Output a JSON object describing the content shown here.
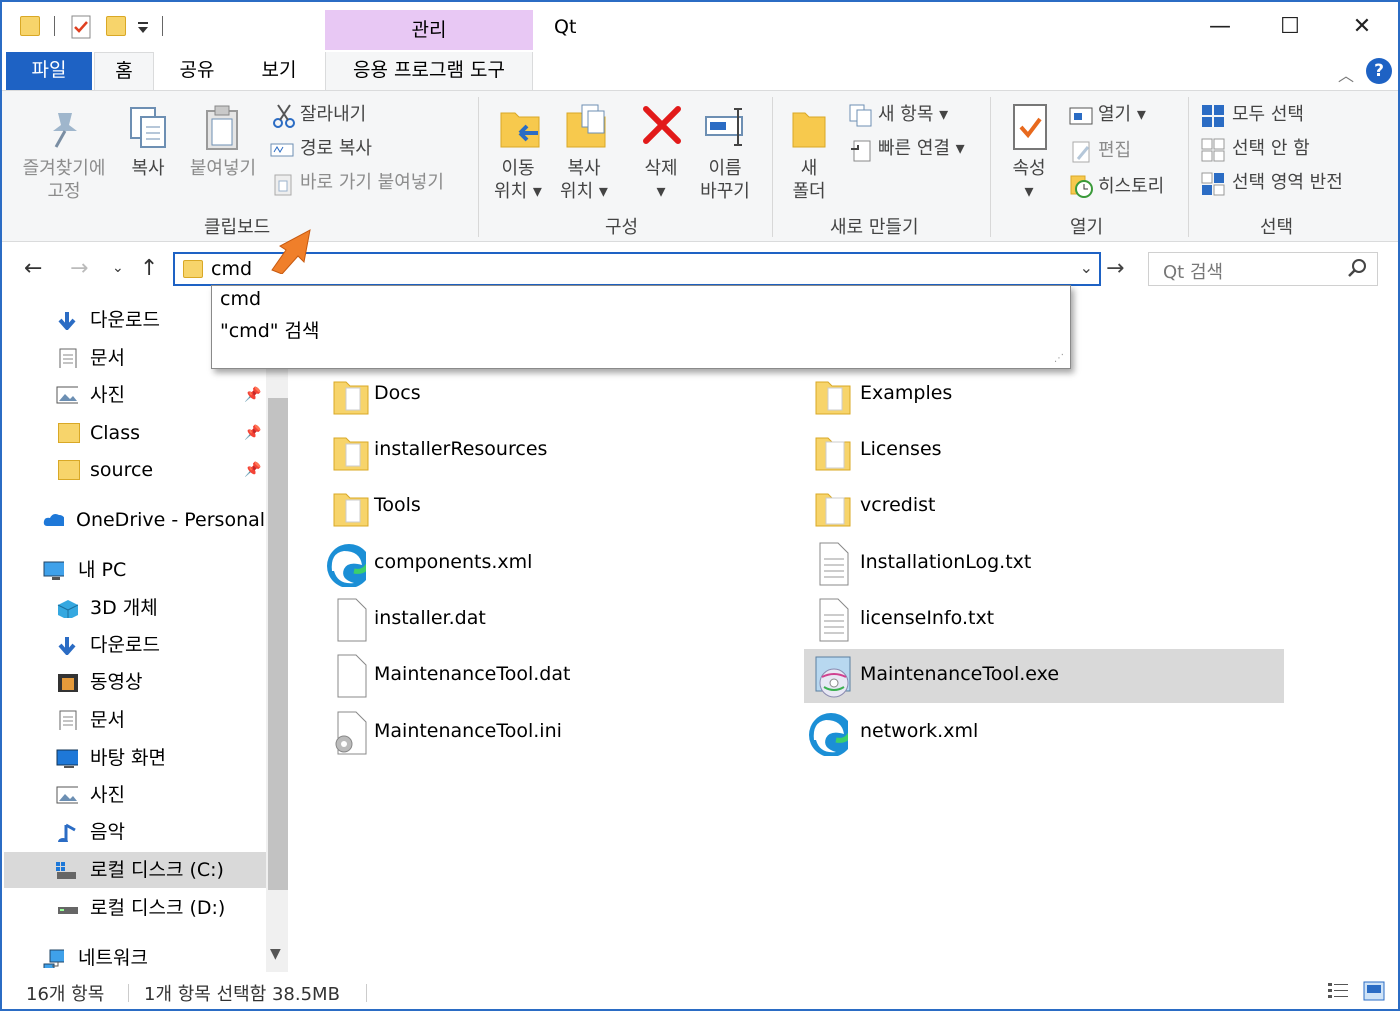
{
  "window": {
    "title": "Qt",
    "context_tab_header": "관리",
    "controls": {
      "minimize": "—",
      "maximize": "☐",
      "close": "✕"
    },
    "accent": "#1e62c4"
  },
  "tabs": [
    {
      "label": "파일"
    },
    {
      "label": "홈"
    },
    {
      "label": "공유"
    },
    {
      "label": "보기"
    },
    {
      "label": "응용 프로그램 도구"
    }
  ],
  "ribbon": {
    "clipboard": {
      "name": "클립보드",
      "pin_label_1": "즐겨찾기에",
      "pin_label_2": "고정",
      "copy": "복사",
      "paste": "붙여넣기",
      "cut": "잘라내기",
      "copy_path": "경로 복사",
      "paste_shortcut": "바로 가기 붙여넣기"
    },
    "organize": {
      "name": "구성",
      "move_1": "이동",
      "move_2": "위치 ▾",
      "copyto_1": "복사",
      "copyto_2": "위치 ▾",
      "delete_1": "삭제",
      "delete_2": "▾",
      "rename_1": "이름",
      "rename_2": "바꾸기"
    },
    "new": {
      "name": "새로 만들기",
      "folder_1": "새",
      "folder_2": "폴더",
      "new_item": "새 항목 ▾",
      "easy_access": "빠른 연결 ▾"
    },
    "open": {
      "name": "열기",
      "properties": "속성",
      "properties_dd": "▾",
      "open": "열기 ▾",
      "edit": "편집",
      "history": "히스토리"
    },
    "select": {
      "name": "선택",
      "select_all": "모두 선택",
      "select_none": "선택 안 함",
      "invert": "선택 영역 반전"
    }
  },
  "address": {
    "value": "cmd",
    "search_placeholder": "Qt 검색"
  },
  "autocomplete": [
    "cmd",
    "\"cmd\" 검색"
  ],
  "sidebar": [
    {
      "label": "다운로드",
      "icon": "download-icon",
      "pinned": false
    },
    {
      "label": "문서",
      "icon": "document-icon",
      "pinned": false
    },
    {
      "label": "사진",
      "icon": "pictures-icon",
      "pinned": true
    },
    {
      "label": "Class",
      "icon": "folder-icon",
      "pinned": true
    },
    {
      "label": "source",
      "icon": "folder-icon",
      "pinned": true
    },
    {
      "label": "OneDrive - Personal",
      "icon": "onedrive-icon",
      "pinned": false
    },
    {
      "label": "내 PC",
      "icon": "pc-icon",
      "pinned": false
    },
    {
      "label": "3D 개체",
      "icon": "3d-objects-icon",
      "pinned": false
    },
    {
      "label": "다운로드",
      "icon": "download-icon",
      "pinned": false
    },
    {
      "label": "동영상",
      "icon": "video-icon",
      "pinned": false
    },
    {
      "label": "문서",
      "icon": "document-icon",
      "pinned": false
    },
    {
      "label": "바탕 화면",
      "icon": "desktop-icon",
      "pinned": false
    },
    {
      "label": "사진",
      "icon": "pictures-icon",
      "pinned": false
    },
    {
      "label": "음악",
      "icon": "music-icon",
      "pinned": false
    },
    {
      "label": "로컬 디스크 (C:)",
      "icon": "drive-c-icon",
      "pinned": false
    },
    {
      "label": "로컬 디스크 (D:)",
      "icon": "drive-d-icon",
      "pinned": false
    },
    {
      "label": "네트워크",
      "icon": "network-icon",
      "pinned": false
    }
  ],
  "files": [
    {
      "name": "Docs",
      "icon": "folder-icon"
    },
    {
      "name": "Examples",
      "icon": "folder-icon"
    },
    {
      "name": "installerResources",
      "icon": "folder-icon"
    },
    {
      "name": "Licenses",
      "icon": "folder-icon"
    },
    {
      "name": "Tools",
      "icon": "folder-icon"
    },
    {
      "name": "vcredist",
      "icon": "folder-icon"
    },
    {
      "name": "components.xml",
      "icon": "edge-icon"
    },
    {
      "name": "InstallationLog.txt",
      "icon": "text-file-icon"
    },
    {
      "name": "installer.dat",
      "icon": "blank-file-icon"
    },
    {
      "name": "licenseInfo.txt",
      "icon": "text-file-icon"
    },
    {
      "name": "MaintenanceTool.dat",
      "icon": "blank-file-icon"
    },
    {
      "name": "MaintenanceTool.exe",
      "icon": "installer-exe-icon",
      "selected": true
    },
    {
      "name": "MaintenanceTool.ini",
      "icon": "settings-file-icon"
    },
    {
      "name": "network.xml",
      "icon": "edge-icon"
    }
  ],
  "status": {
    "count": "16개 항목",
    "selection": "1개 항목 선택함 38.5MB"
  }
}
